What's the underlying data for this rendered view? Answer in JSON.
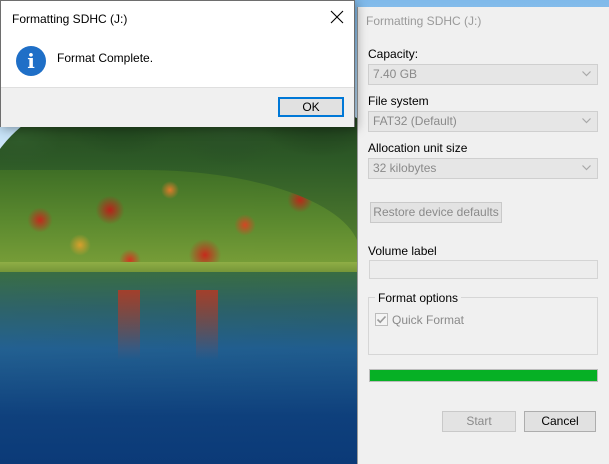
{
  "message_box": {
    "title": "Formatting SDHC (J:)",
    "message": "Format Complete.",
    "icon": "info-icon",
    "ok_label": "OK"
  },
  "format_dialog": {
    "title": "Formatting SDHC (J:)",
    "capacity_label": "Capacity:",
    "capacity_value": "7.40 GB",
    "filesystem_label": "File system",
    "filesystem_value": "FAT32 (Default)",
    "allocation_label": "Allocation unit size",
    "allocation_value": "32 kilobytes",
    "restore_label": "Restore device defaults",
    "volume_label": "Volume label",
    "volume_value": "",
    "format_options_label": "Format options",
    "quick_format_label": "Quick Format",
    "quick_format_checked": true,
    "progress_fraction": 1.0,
    "start_label": "Start",
    "cancel_label": "Cancel"
  },
  "colors": {
    "progress": "#06b025",
    "focus_border": "#0078d7",
    "info_icon": "#1f6fc7"
  }
}
